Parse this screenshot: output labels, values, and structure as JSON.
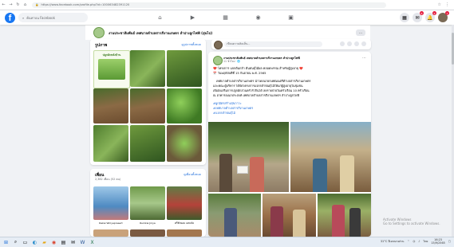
{
  "browser": {
    "url": "https://www.facebook.com/profile.php?id=100063482391120",
    "nav_back": "←",
    "nav_forward": "→",
    "nav_reload": "↻",
    "nav_home": "⌂",
    "extensions": [
      "☆",
      "⋮"
    ]
  },
  "fb": {
    "logo": "f",
    "search_placeholder": "ค้นหาบน Facebook",
    "tabs": [
      "home-icon",
      "watch-icon",
      "marketplace-icon",
      "groups-icon",
      "gaming-icon"
    ],
    "tab_glyphs": [
      "⌂",
      "▶",
      "▦",
      "◉",
      "▣"
    ],
    "right_icons": [
      {
        "name": "menu-icon",
        "glyph": "▦",
        "badge": ""
      },
      {
        "name": "messenger-icon",
        "glyph": "✉",
        "badge": "6"
      },
      {
        "name": "notifications-icon",
        "glyph": "🔔",
        "badge": "9"
      },
      {
        "name": "profile-avatar",
        "glyph": "●",
        "badge": "1"
      }
    ]
  },
  "group": {
    "title": "งานประชาสัมพันธ์ เทศบาลตำบลสารภีงานเกษตร ลำปางลูกไฟฟ้ (อุ่นไป)",
    "more": "..."
  },
  "photos_card": {
    "title": "รูปภาพ",
    "see_all": "ดูรูปภาพทั้งหมด",
    "poster_text": "ปลูกผักหลังบ้าน"
  },
  "friends_card": {
    "title": "เพื่อน",
    "see_all": "ดูเพื่อนทั้งหมด",
    "count": "2,362 เพื่อน (52 คน)",
    "friends": [
      "Rakai Wiriyaprasert",
      "Rumkai Jiriya",
      "ศรีฟ้ายอม แหจเลิง"
    ]
  },
  "create_post": {
    "placeholder": "เขียนความคิดเห็น..."
  },
  "post": {
    "author": "งานประชาสัมพันธ์ เทศบาลตำบลสารภีงานเกษตร ลำปางลูกไฟฟ้",
    "time": "11 ชั่วโมง · 🌐",
    "line1": "❤️ โครงการ แจกต้นกล้า ต้นพันธุ์ไม้ผล คลอดพรรณ สำหรับผู้สูงอายุ ❤️",
    "line2": "📅 วันพฤหัสบดีที่ 15 กันยายน พ.ศ. 2565",
    "body": [
      "เทศบาลตำบลสารภีงานเกษตร นำโดยนายกเทศมนตรีตำบลสารภีงานเกษตร",
      "และคณะผู้บริหาร ได้จัดโครงการแจกกล้าพันธุ์ไม้ให้แก่ผู้สูงอายุในชุมชน",
      "เพื่อส่งเสริมการปลูกผักสวนครัวรั้วกินได้ ลดรายจ่ายในครัวเรือน 10 ครัวเรือน",
      "ณ อาคารอเนกประสงค์ เทศบาลตำบลสารภีงานเกษตร ลำปางลูกไฟฟ้"
    ],
    "hashtags": [
      "#ผูกมิตรสร้างสุขภาวะ",
      "#เทศบาลตำบลสารภีงานเกษตร",
      "#แจกกล้าพันธุ์ไม้"
    ]
  },
  "taskbar": {
    "weather": "31°C มีเมฆบางส่วน",
    "lang": "ไทย",
    "time": "16:23",
    "date": "15/9/2565"
  },
  "watermark": {
    "line1": "Activate Windows",
    "line2": "Go to Settings to activate Windows."
  }
}
